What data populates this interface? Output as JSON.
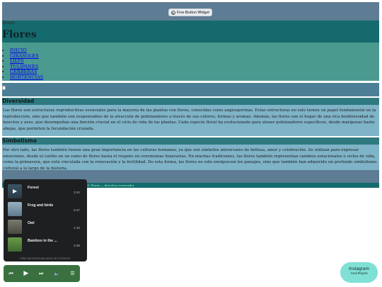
{
  "widget": {
    "label": "Free Button Widget"
  },
  "header": {
    "logo_alt": "Home",
    "title": "Flores"
  },
  "nav": {
    "items": [
      "INICIO",
      "GIRASOLES",
      "LILYS",
      "TULIPANES",
      "GERBERAS",
      "HORTENCIAS"
    ]
  },
  "sections": [
    {
      "heading": "Diversidad",
      "body": "Las flores son estructuras reproductivas esenciales para la mayoría de las plantas con flores, conocidas como angiospermas. Estas estructuras no solo tienen un papel fundamental en la reproducción, sino que también son responsables de la atracción de polinizadores a través de sus colores, formas y aromas. Además, las flores son el hogar de una rica biodiversidad de insectos y aves, que desempeñan una función crucial en el ciclo de vida de las plantas. Cada especie floral ha evolucionado para atraer polinizadores específicos, desde mariposas hasta abejas, que permiten la fecundación cruzada."
    },
    {
      "heading": "Simbolismo",
      "body": "Por otro lado, las flores también tienen una gran importancia en las culturas humanas, ya que son símbolos universales de belleza, amor y celebración. Se utilizan para expresar emociones, desde el cariño en un ramo de flores hasta el respeto en ceremonias funerarias. En muchas tradiciones, las flores también representan cambios estacionales o ciclos de vida, como la primavera, que está vinculada con la renovación y la fertilidad. De esta forma, las flores no solo enriquecen los paisajes, sino que también han adquirido un profundo simbolismo cultural a lo largo de la historia."
    }
  ],
  "footer": {
    "text": "© Flores — derechos reservados"
  },
  "player": {
    "tracks": [
      {
        "name": "Forest",
        "duration": "2:42"
      },
      {
        "name": "Frog and birds",
        "duration": "0:47"
      },
      {
        "name": "Owl",
        "duration": "1:15"
      },
      {
        "name": "Bamboo in the ...",
        "duration": "2:38"
      }
    ],
    "credit": "FREE BACKGROUND MUSIC BY ELFSIGHT"
  },
  "controls": {
    "prev": "⏮",
    "play": "▶",
    "next": "⏭",
    "volume": "🔈",
    "playlist": "☰"
  },
  "instagram": {
    "title": "Instagram",
    "user": "Azul Reyes"
  },
  "colors": {
    "header": "#146a6c",
    "nav": "#4b9a90",
    "section_bg": "#7fb3c7",
    "player": "#1d1f21",
    "instagram": "#7fe0d6"
  }
}
